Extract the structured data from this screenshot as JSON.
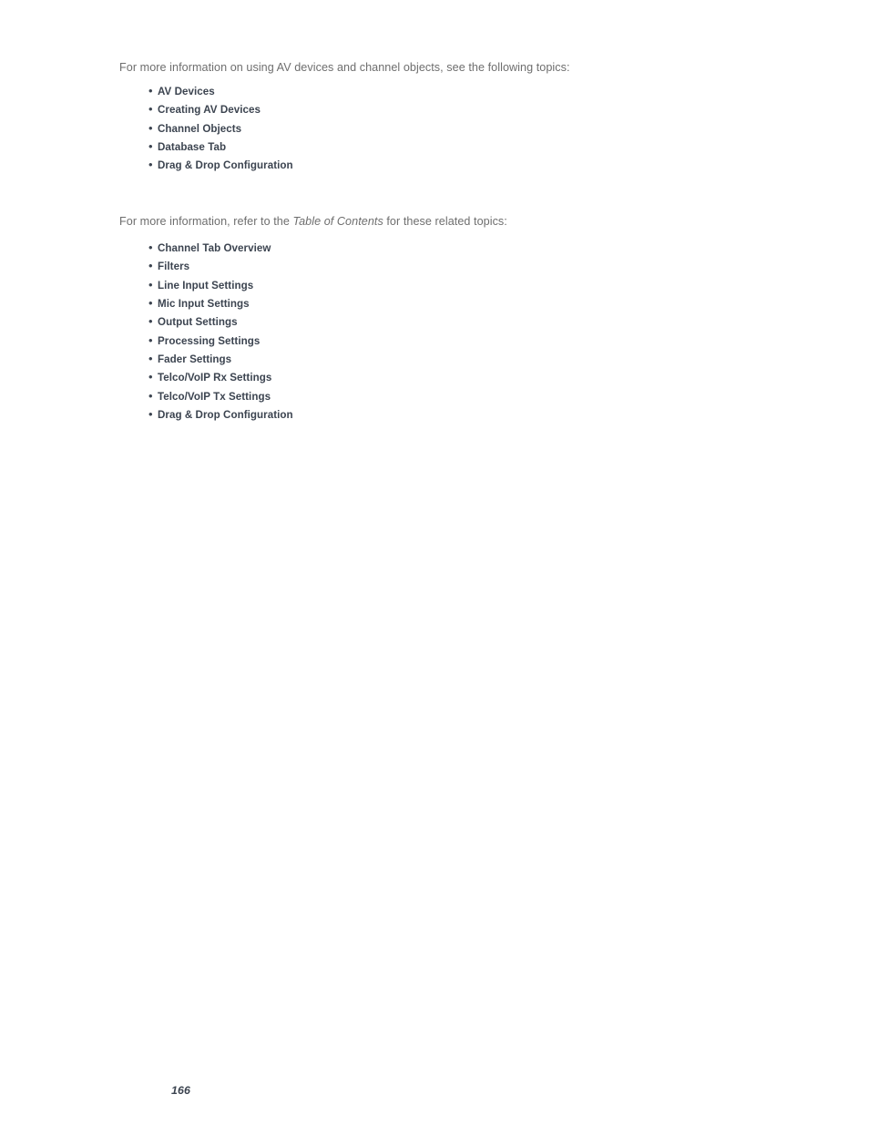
{
  "page": {
    "number": "166",
    "background_color": "#ffffff",
    "body_text_color": "#6e6e6e",
    "heading_text_color": "#3c4450"
  },
  "sections": [
    {
      "intro": {
        "before_emphasis": "For more information on using AV devices and channel objects, see the following topics:",
        "emphasis": "",
        "after_emphasis": ""
      },
      "topics": [
        "AV Devices",
        "Creating AV Devices",
        "Channel Objects",
        "Database Tab",
        "Drag & Drop Configuration"
      ]
    },
    {
      "intro": {
        "before_emphasis": "For more information, refer to the ",
        "emphasis": "Table of Contents",
        "after_emphasis": " for these related topics:"
      },
      "topics": [
        "Channel Tab Overview",
        "Filters",
        "Line Input Settings",
        "Mic Input Settings",
        "Output Settings",
        "Processing Settings",
        "Fader Settings",
        "Telco/VoIP Rx Settings",
        "Telco/VoIP Tx Settings",
        "Drag & Drop Configuration"
      ]
    }
  ],
  "bullet_glyph": "•"
}
